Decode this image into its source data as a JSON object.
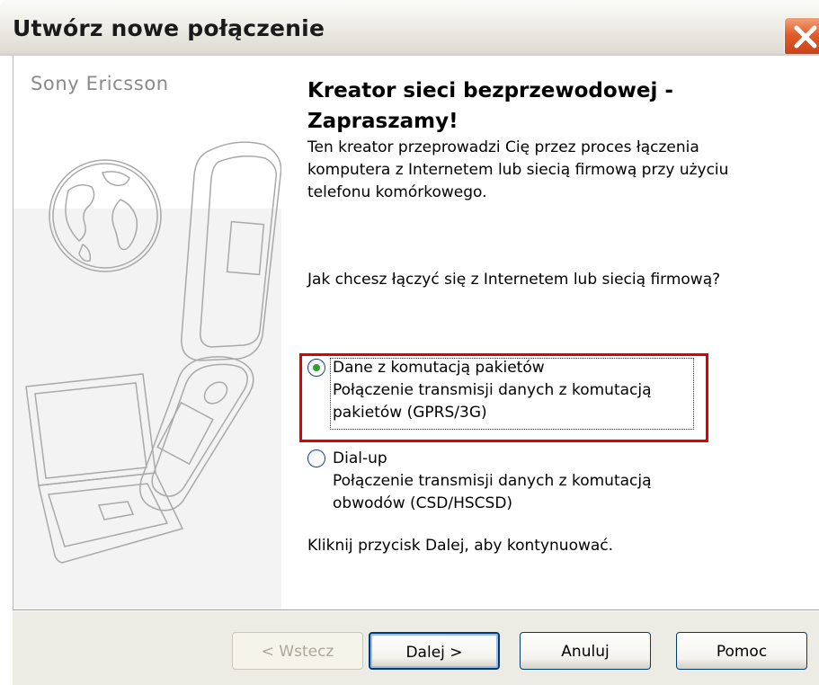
{
  "window": {
    "title": "Utwórz nowe połączenie"
  },
  "sidebar": {
    "brand": "Sony Ericsson"
  },
  "content": {
    "title": "Kreator sieci bezprzewodowej - Zapraszamy!",
    "intro": "Ten kreator przeprowadzi Cię przez proces łączenia komputera z Internetem lub siecią firmową przy użyciu telefonu komórkowego.",
    "question": "Jak chcesz łączyć się z Internetem lub siecią firmową?",
    "options": [
      {
        "label": "Dane z komutacją pakietów",
        "description": "Połączenie transmisji danych z komutacją pakietów (GPRS/3G)",
        "selected": true,
        "highlighted": true
      },
      {
        "label": "Dial-up",
        "description": "Połączenie transmisji danych z komutacją obwodów (CSD/HSCSD)",
        "selected": false,
        "highlighted": false
      }
    ],
    "continue_hint": "Kliknij przycisk Dalej, aby kontynuować."
  },
  "buttons": {
    "back": "< Wstecz",
    "next": "Dalej >",
    "cancel": "Anuluj",
    "help": "Pomoc"
  },
  "colors": {
    "highlight_border": "#e00000",
    "radio_selected_dot": "#33a02c",
    "close_button": "#e15c2a"
  },
  "icons": {
    "close": "close-icon",
    "globe": "globe-icon",
    "phone": "flip-phone-icon",
    "laptop": "laptop-icon"
  }
}
